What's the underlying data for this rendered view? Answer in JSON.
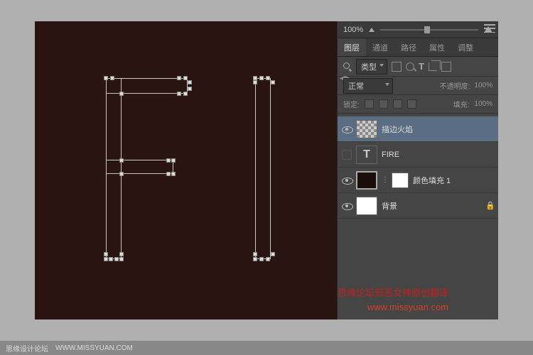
{
  "zoom": {
    "value": "100%"
  },
  "tabs": {
    "t1": "图层",
    "t2": "通道",
    "t3": "路径",
    "t4": "属性",
    "t5": "调整"
  },
  "filter": {
    "type_label": "类型"
  },
  "mode": {
    "blend": "正常",
    "opacity_label": "不透明度:",
    "opacity_val": "100%"
  },
  "lock": {
    "label": "锁定:",
    "fill_label": "填充:",
    "fill_val": "100%"
  },
  "layers": {
    "l1": "描边火焰",
    "l2": "FIRE",
    "l3": "颜色填充 1",
    "l4": "背景"
  },
  "watermark": {
    "line1": "思缘论坛邪恶女神原创翻译",
    "line2": "www.missyuan.com"
  },
  "footer": {
    "site": "思缘设计论坛",
    "url": "WWW.MISSYUAN.COM"
  }
}
